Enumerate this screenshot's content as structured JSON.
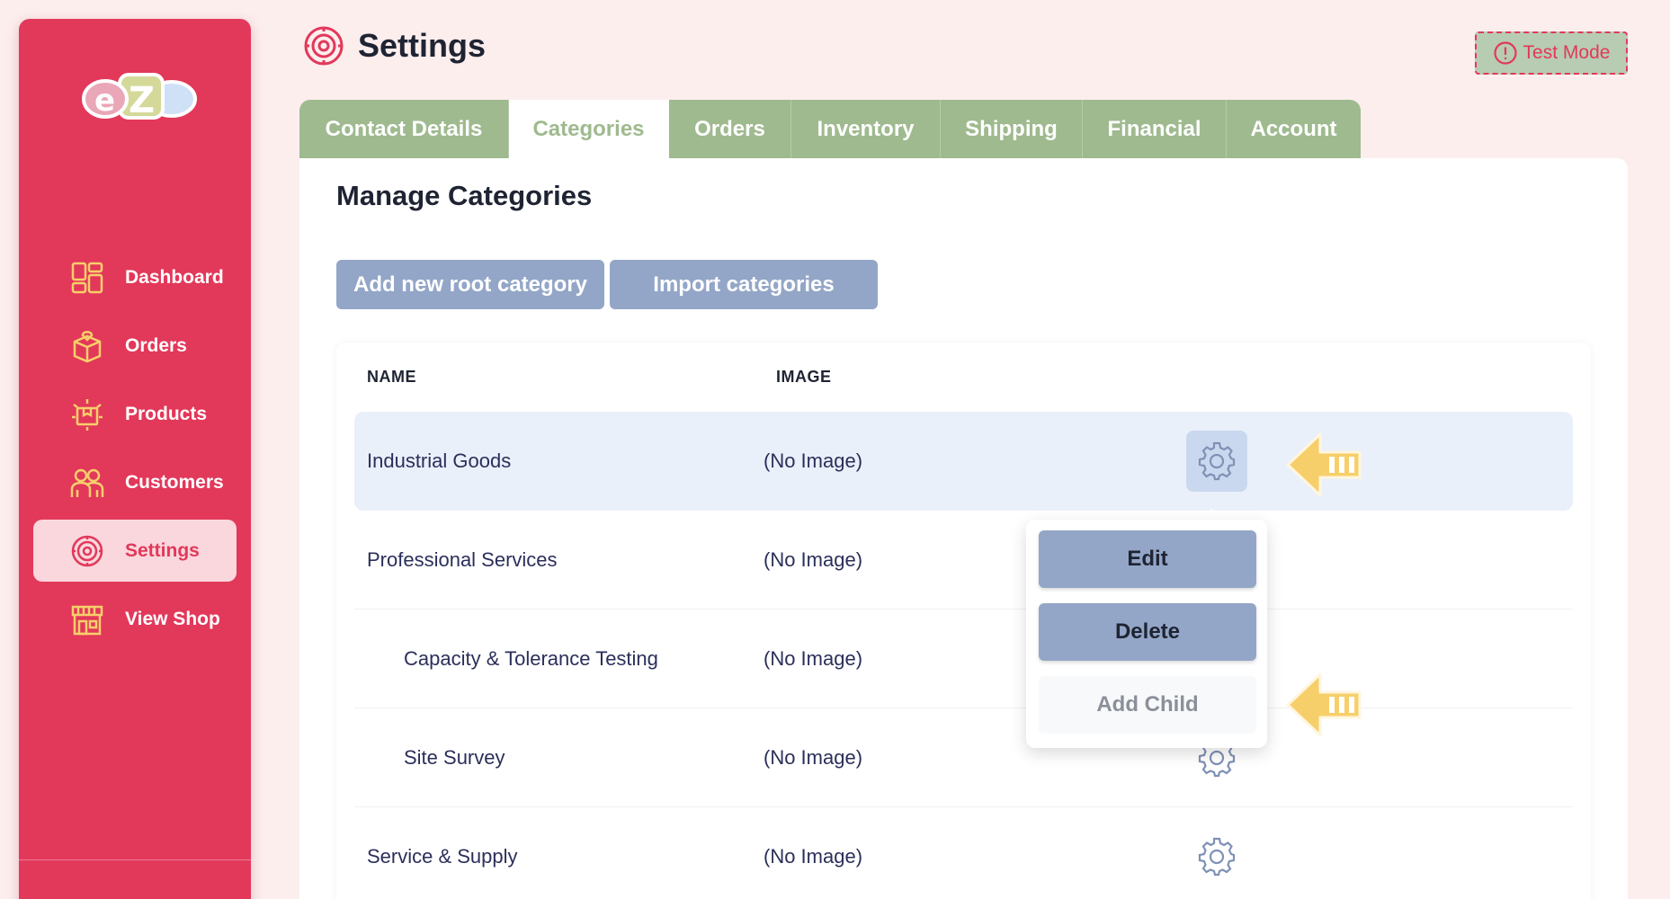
{
  "app": {
    "logo_text": "eZ"
  },
  "sidebar": {
    "items": [
      {
        "label": "Dashboard",
        "icon": "dashboard-icon"
      },
      {
        "label": "Orders",
        "icon": "orders-box-icon"
      },
      {
        "label": "Products",
        "icon": "products-icon"
      },
      {
        "label": "Customers",
        "icon": "customers-icon"
      },
      {
        "label": "Settings",
        "icon": "settings-icon",
        "active": true
      },
      {
        "label": "View Shop",
        "icon": "shop-icon"
      }
    ]
  },
  "header": {
    "title": "Settings",
    "test_mode_label": "Test Mode"
  },
  "tabs": [
    {
      "label": "Contact Details"
    },
    {
      "label": "Categories",
      "active": true
    },
    {
      "label": "Orders"
    },
    {
      "label": "Inventory"
    },
    {
      "label": "Shipping"
    },
    {
      "label": "Financial"
    },
    {
      "label": "Account"
    }
  ],
  "main": {
    "section_title": "Manage Categories",
    "add_root_label": "Add new root category",
    "import_label": "Import categories",
    "columns": {
      "name": "NAME",
      "image": "IMAGE"
    },
    "rows": [
      {
        "name": "Industrial Goods",
        "image": "(No Image)",
        "level": 0
      },
      {
        "name": "Professional Services",
        "image": "(No Image)",
        "level": 0
      },
      {
        "name": "Capacity & Tolerance Testing",
        "image": "(No Image)",
        "level": 1
      },
      {
        "name": "Site Survey",
        "image": "(No Image)",
        "level": 1
      },
      {
        "name": "Service & Supply",
        "image": "(No Image)",
        "level": 0
      }
    ]
  },
  "menu": {
    "edit_label": "Edit",
    "delete_label": "Delete",
    "add_child_label": "Add Child"
  },
  "colors": {
    "sidebar": "#e2385a",
    "tab": "#9fba8f",
    "button": "#93a6c7",
    "arrow": "#f7cf6a"
  }
}
